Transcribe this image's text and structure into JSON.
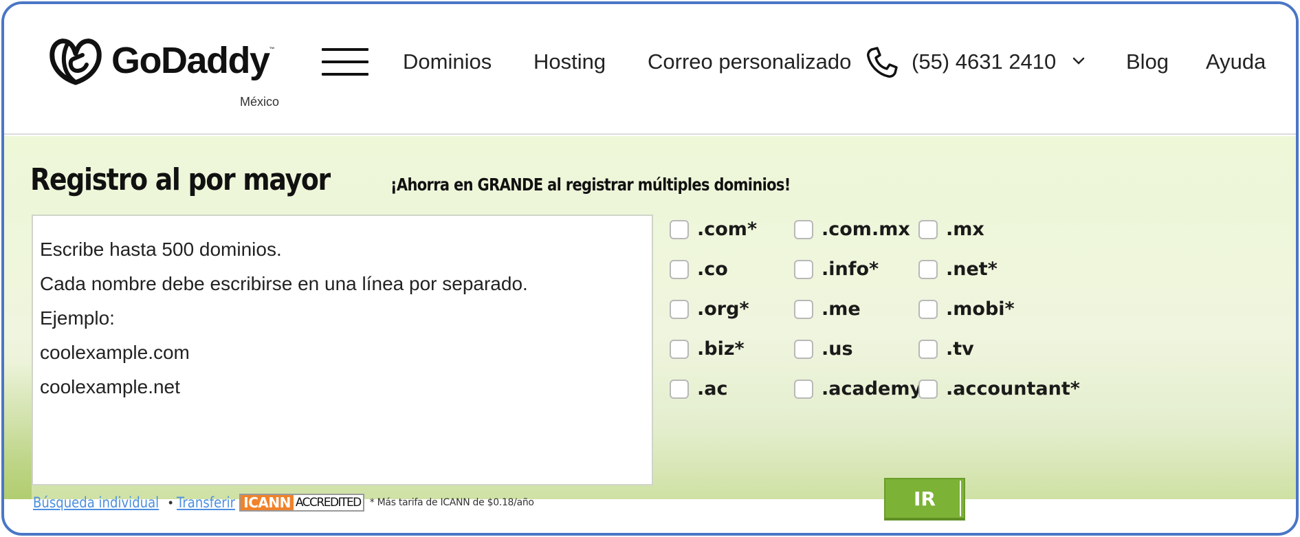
{
  "header": {
    "brand": "GoDaddy",
    "trademark": "™",
    "region": "México",
    "nav": {
      "dominios": "Dominios",
      "hosting": "Hosting",
      "correo": "Correo personalizado",
      "phone": "(55) 4631 2410",
      "blog": "Blog",
      "ayuda": "Ayuda"
    },
    "icons": {
      "logo": "godaddy-logo-icon",
      "menu": "hamburger-menu-icon",
      "phone": "phone-icon",
      "dropdown": "chevron-down-icon"
    }
  },
  "bulk": {
    "title": "Registro al por mayor",
    "subtitle": "¡Ahorra en GRANDE al registrar múltiples dominios!",
    "textarea_placeholder_lines": [
      "Escribe hasta 500 dominios.",
      "Cada nombre debe escribirse en una línea por separado.",
      "Ejemplo:",
      "coolexample.com",
      "coolexample.net"
    ],
    "tlds": [
      {
        "label": ".com*",
        "checked": false
      },
      {
        "label": ".com.mx",
        "checked": false
      },
      {
        "label": ".mx",
        "checked": false
      },
      {
        "label": ".co",
        "checked": false
      },
      {
        "label": ".info*",
        "checked": false
      },
      {
        "label": ".net*",
        "checked": false
      },
      {
        "label": ".org*",
        "checked": false
      },
      {
        "label": ".me",
        "checked": false
      },
      {
        "label": ".mobi*",
        "checked": false
      },
      {
        "label": ".biz*",
        "checked": false
      },
      {
        "label": ".us",
        "checked": false
      },
      {
        "label": ".tv",
        "checked": false
      },
      {
        "label": ".ac",
        "checked": false
      },
      {
        "label": ".academy*",
        "checked": false
      },
      {
        "label": ".accountant*",
        "checked": false
      }
    ],
    "submit_label": "IR"
  },
  "footer": {
    "single_search": "Búsqueda individual",
    "separator": "•",
    "transfer": "Transferir",
    "icann_a": "ICANN",
    "icann_b": "ACCREDITED",
    "footnote": "* Más tarifa de ICANN de $0.18/año"
  },
  "colors": {
    "frame_border": "#4a76c6",
    "button_green": "#7cb236",
    "link_blue": "#4a8fe0",
    "icann_orange": "#f0822a",
    "panel_top": "#eef7d8",
    "panel_bottom": "#cfe1a4"
  }
}
